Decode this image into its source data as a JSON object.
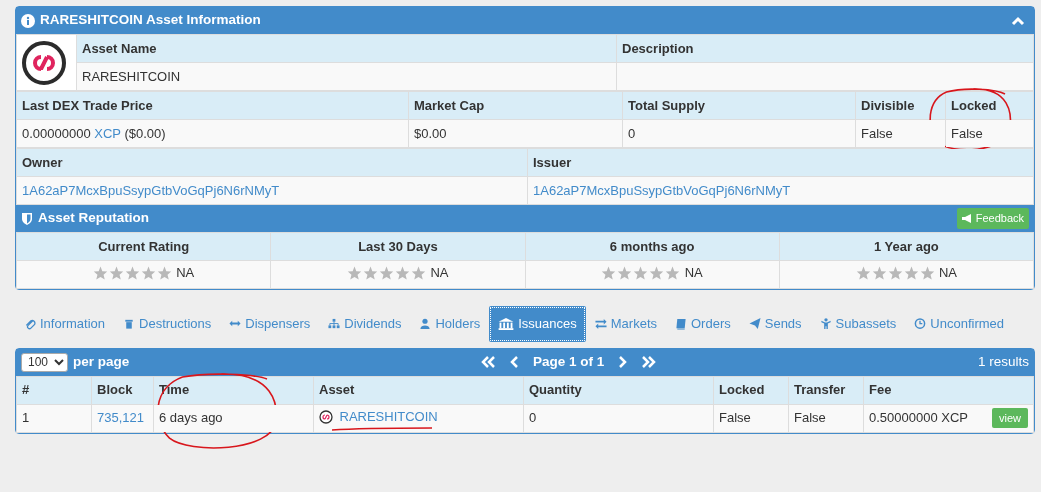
{
  "asset_panel": {
    "title": "RARESHITCOIN Asset Information",
    "asset_name_label": "Asset Name",
    "asset_name": "RARESHITCOIN",
    "description_label": "Description",
    "stats": [
      {
        "label": "Last DEX Trade Price",
        "value": "0.00000000",
        "link": "XCP",
        "after": "($0.00)",
        "circled": false
      },
      {
        "label": "Market Cap",
        "value": "$0.00",
        "circled": false
      },
      {
        "label": "Total Supply",
        "value": "0",
        "circled": false
      },
      {
        "label": "Divisible",
        "value": "False",
        "circled": false
      },
      {
        "label": "Locked",
        "value": "False",
        "circled": true
      }
    ],
    "owner_label": "Owner",
    "owner": "1A62aP7McxBpuSsypGtbVoGqPj6N6rNMyT",
    "issuer_label": "Issuer",
    "issuer": "1A62aP7McxBpuSsypGtbVoGqPj6N6rNMyT"
  },
  "reputation": {
    "title": "Asset Reputation",
    "feedback_button": "Feedback",
    "ratings": [
      {
        "label": "Current Rating",
        "stars": 0,
        "value": "NA"
      },
      {
        "label": "Last 30 Days",
        "stars": 0,
        "value": "NA"
      },
      {
        "label": "6 months ago",
        "stars": 0,
        "value": "NA"
      },
      {
        "label": "1 Year ago",
        "stars": 0,
        "value": "NA"
      }
    ]
  },
  "tabs": [
    {
      "label": "Information",
      "selected": false
    },
    {
      "label": "Destructions",
      "selected": false
    },
    {
      "label": "Dispensers",
      "selected": false
    },
    {
      "label": "Dividends",
      "selected": false
    },
    {
      "label": "Holders",
      "selected": false
    },
    {
      "label": "Issuances",
      "selected": true
    },
    {
      "label": "Markets",
      "selected": false
    },
    {
      "label": "Orders",
      "selected": false
    },
    {
      "label": "Sends",
      "selected": false
    },
    {
      "label": "Subassets",
      "selected": false
    },
    {
      "label": "Unconfirmed",
      "selected": false
    }
  ],
  "issuances": {
    "per_page": "100",
    "per_page_label": "per page",
    "page_label": "Page 1 of 1",
    "results": "1 results",
    "columns": [
      {
        "label": "#",
        "circled": false
      },
      {
        "label": "Block",
        "circled": false
      },
      {
        "label": "Time",
        "circled": true
      },
      {
        "label": "Asset",
        "circled": false
      },
      {
        "label": "Quantity",
        "circled": false
      },
      {
        "label": "Locked",
        "circled": false
      },
      {
        "label": "Transfer",
        "circled": false
      },
      {
        "label": "Fee",
        "circled": false
      }
    ],
    "rows": [
      {
        "cells": [
          "1",
          "735,121",
          "6 days ago",
          "RARESHITCOIN",
          "0",
          "False",
          "False",
          "0.50000000 XCP"
        ],
        "asset_underlined": true,
        "view_button": "view"
      }
    ]
  }
}
